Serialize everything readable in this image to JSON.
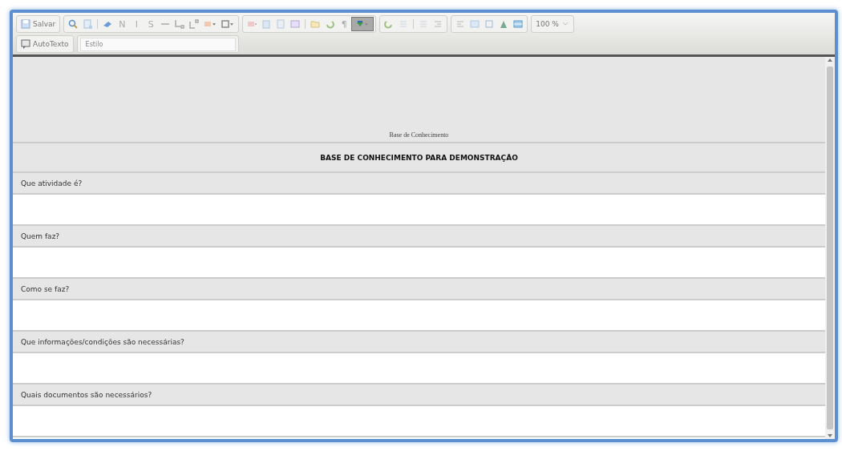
{
  "toolbar": {
    "rows": [
      {
        "groups": [
          {
            "items": [
              {
                "kind": "button",
                "label": "Salvar",
                "active": false
              }
            ]
          },
          {
            "items": [
              {
                "kind": "icon",
                "active": false
              },
              {
                "kind": "icon",
                "active": false
              },
              {
                "kind": "sep"
              },
              {
                "kind": "icon",
                "active": false
              },
              {
                "kind": "glyph",
                "label": "N",
                "active": false
              },
              {
                "kind": "glyph",
                "label": "I",
                "active": false
              },
              {
                "kind": "glyph",
                "label": "S",
                "active": false
              },
              {
                "kind": "icon",
                "active": false
              },
              {
                "kind": "icon",
                "active": false
              },
              {
                "kind": "icon",
                "active": false
              },
              {
                "kind": "menu",
                "active": false
              },
              {
                "kind": "menu",
                "active": false
              }
            ]
          },
          {
            "items": [
              {
                "kind": "icon",
                "active": false
              },
              {
                "kind": "icon",
                "active": false
              },
              {
                "kind": "icon",
                "active": false
              },
              {
                "kind": "icon",
                "active": false
              },
              {
                "kind": "sep"
              },
              {
                "kind": "icon",
                "active": false
              },
              {
                "kind": "icon",
                "active": false
              },
              {
                "kind": "glyph",
                "label": "¶",
                "active": false
              },
              {
                "kind": "menu",
                "active": true
              }
            ]
          },
          {
            "items": [
              {
                "kind": "icon",
                "active": false
              },
              {
                "kind": "icon",
                "active": false
              },
              {
                "kind": "sep"
              },
              {
                "kind": "icon",
                "active": false
              },
              {
                "kind": "icon",
                "active": false
              }
            ]
          },
          {
            "items": [
              {
                "kind": "icon",
                "active": false
              },
              {
                "kind": "icon",
                "active": false
              },
              {
                "kind": "icon",
                "active": false
              },
              {
                "kind": "icon",
                "active": false
              },
              {
                "kind": "icon",
                "active": false
              }
            ]
          },
          {
            "items": [
              {
                "kind": "zoom",
                "label": "100 %",
                "active": false
              }
            ]
          }
        ]
      },
      {
        "groups": [
          {
            "items": [
              {
                "kind": "button",
                "label": "AutoTexto",
                "active": false
              }
            ]
          },
          {
            "items": [
              {
                "kind": "select",
                "placeholder": "Estilo"
              }
            ]
          }
        ]
      }
    ]
  },
  "document": {
    "header": "Base de Conhecimento",
    "title": "BASE DE CONHECIMENTO PARA DEMONSTRAÇÃO",
    "questions": [
      {
        "label": "Que atividade é?"
      },
      {
        "label": "Quem faz?"
      },
      {
        "label": "Como se faz?"
      },
      {
        "label": "Que informações/condições são necessárias?"
      },
      {
        "label": "Quais documentos são necessários?"
      }
    ]
  }
}
